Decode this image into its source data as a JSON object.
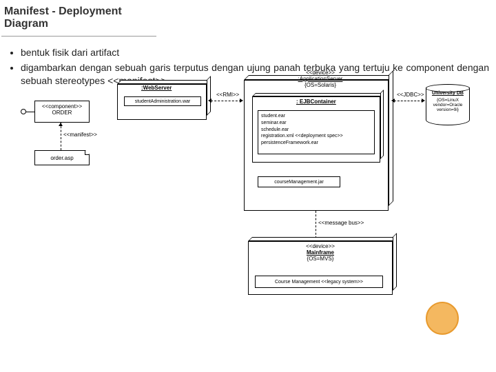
{
  "title": "Manifest - Deployment Diagram",
  "bullets": [
    "bentuk fisik dari artifact",
    "digambarkan dengan sebuah garis terputus dengan ujung panah terbuka yang tertuju ke component dengan sebuah stereotypes <<manifest>>"
  ],
  "component_order": {
    "stereotype": "<<component>>",
    "name": "ORDER"
  },
  "manifest_label": "<<manifest>>",
  "artifact_order": "order.asp",
  "webserver": {
    "title": ":WebServer",
    "file": "studentAdministration.war"
  },
  "rmi": "<<RMI>>",
  "appserver": {
    "stereotype": "<<device>>",
    "name": ":ApplicationServer",
    "tagged": "{OS=Solaris}"
  },
  "ejb": {
    "title": ": EJBContainer",
    "files": [
      "student.ear",
      "seminar.ear",
      "schedule.ear",
      "registration.xml <<deployment spec>>",
      "persistenceFramework.ear"
    ]
  },
  "course_jar": "courseManagement.jar",
  "jdbc": "<<JDBC>>",
  "db": {
    "name": "University DB",
    "tagged": "{OS=LinuX\nvendor=Oracle\nversion=9i}"
  },
  "msgbus": "<<message bus>>",
  "mainframe": {
    "stereotype": "<<device>>",
    "name": "Mainframe",
    "tagged": "{OS=MVS}"
  },
  "legacy": "Course Management <<legacy system>>"
}
